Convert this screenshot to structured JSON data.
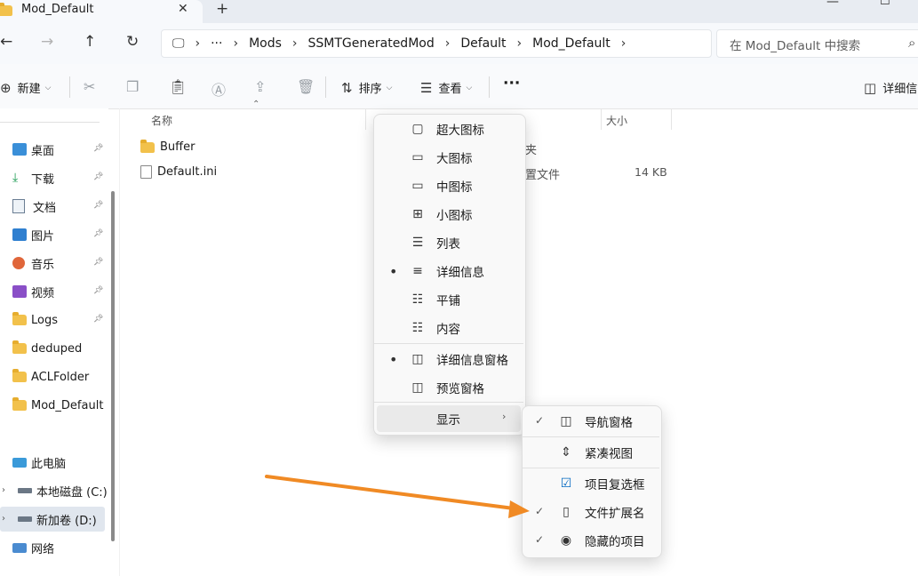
{
  "tab": {
    "title": "Mod_Default",
    "close": "✕",
    "add": "+"
  },
  "window": {
    "minimize": "—",
    "maximize": "☐"
  },
  "nav": {
    "back": "←",
    "forward": "→",
    "up": "↑",
    "refresh": "↻"
  },
  "breadcrumb": {
    "more": "···",
    "items": [
      "Mods",
      "SSMTGeneratedMod",
      "Default",
      "Mod_Default"
    ],
    "sep": "›"
  },
  "search": {
    "placeholder": "在 Mod_Default 中搜索"
  },
  "commandbar": {
    "new_label": "新建",
    "sort_label": "排序",
    "view_label": "查看",
    "more": "···",
    "details_pane_label": "详细信"
  },
  "sidebar": {
    "quick": [
      {
        "label": "桌面",
        "icon": "desktop-icon"
      },
      {
        "label": "下载",
        "icon": "download-icon"
      },
      {
        "label": "文档",
        "icon": "document-icon"
      },
      {
        "label": "图片",
        "icon": "picture-icon"
      },
      {
        "label": "音乐",
        "icon": "music-icon"
      },
      {
        "label": "视频",
        "icon": "video-icon"
      },
      {
        "label": "Logs",
        "icon": "folder-icon"
      },
      {
        "label": "deduped",
        "icon": "folder-icon"
      },
      {
        "label": "ACLFolder",
        "icon": "folder-icon"
      },
      {
        "label": "Mod_Default",
        "icon": "folder-icon"
      }
    ],
    "this_pc": "此电脑",
    "drive_c": "本地磁盘 (C:)",
    "drive_d": "新加卷 (D:)",
    "network": "网络"
  },
  "columns": {
    "name": "名称",
    "size": "大小"
  },
  "files": [
    {
      "name": "Buffer",
      "type_partial": "夹",
      "size": ""
    },
    {
      "name": "Default.ini",
      "type_partial": "置文件",
      "size": "14 KB"
    }
  ],
  "view_menu": {
    "items": [
      {
        "label": "超大图标",
        "icon": "extra-large-icons-icon",
        "glyph": "▢",
        "selected": false
      },
      {
        "label": "大图标",
        "icon": "large-icons-icon",
        "glyph": "▭",
        "selected": false
      },
      {
        "label": "中图标",
        "icon": "medium-icons-icon",
        "glyph": "▭",
        "selected": false
      },
      {
        "label": "小图标",
        "icon": "small-icons-icon",
        "glyph": "⊞",
        "selected": false
      },
      {
        "label": "列表",
        "icon": "list-icon",
        "glyph": "☰",
        "selected": false
      },
      {
        "label": "详细信息",
        "icon": "details-icon",
        "glyph": "≡",
        "selected": true
      },
      {
        "label": "平铺",
        "icon": "tiles-icon",
        "glyph": "☷",
        "selected": false
      },
      {
        "label": "内容",
        "icon": "content-icon",
        "glyph": "☷",
        "selected": false
      }
    ],
    "panes": [
      {
        "label": "详细信息窗格",
        "icon": "details-pane-icon",
        "glyph": "◫",
        "selected": true
      },
      {
        "label": "预览窗格",
        "icon": "preview-pane-icon",
        "glyph": "◫",
        "selected": false
      }
    ],
    "show_label": "显示",
    "dot": "•",
    "chevron": "›"
  },
  "show_menu": {
    "items": [
      {
        "label": "导航窗格",
        "icon": "navigation-pane-icon",
        "glyph": "◫",
        "checked": true
      },
      {
        "label": "紧凑视图",
        "icon": "compact-view-icon",
        "glyph": "⇕",
        "checked": false
      },
      {
        "label": "项目复选框",
        "icon": "item-checkbox-icon",
        "glyph": "☑",
        "checked": false
      },
      {
        "label": "文件扩展名",
        "icon": "file-extension-icon",
        "glyph": "▯",
        "checked": true
      },
      {
        "label": "隐藏的项目",
        "icon": "hidden-items-icon",
        "glyph": "◉",
        "checked": true
      }
    ],
    "check": "✓"
  },
  "colors": {
    "arrow": "#f08a24",
    "folder": "#f2c14b",
    "accent": "#0067c0"
  }
}
